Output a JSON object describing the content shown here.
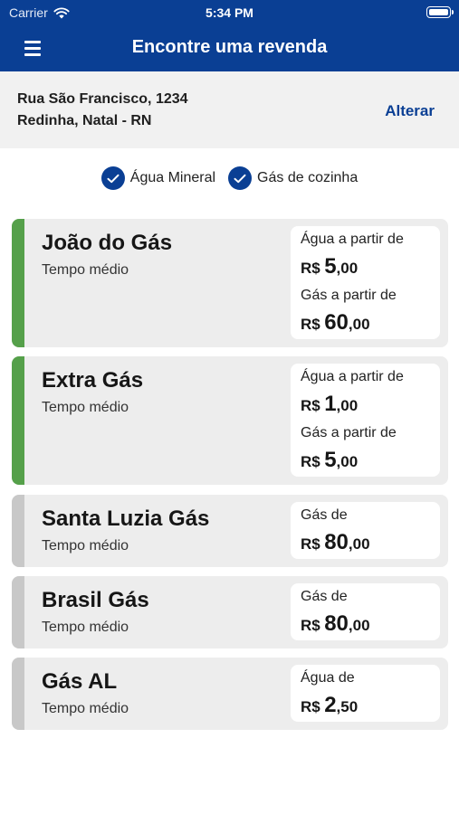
{
  "status_bar": {
    "carrier": "Carrier",
    "time": "5:34 PM"
  },
  "header": {
    "title": "Encontre uma revenda"
  },
  "address": {
    "line1": "Rua São Francisco, 1234",
    "line2": "Redinha, Natal - RN",
    "change_label": "Alterar"
  },
  "filters": [
    {
      "label": "Água Mineral",
      "checked": true
    },
    {
      "label": "Gás de cozinha",
      "checked": true
    }
  ],
  "colors": {
    "brand": "#0a3f94",
    "open_bar": "#55a04a",
    "closed_bar": "#c8c8c8"
  },
  "stores": [
    {
      "name": "João do Gás",
      "subtitle": "Tempo médio",
      "open": true,
      "prices": [
        {
          "label": "Água a partir de",
          "currency": "R$",
          "int": "5",
          "cents": ",00"
        },
        {
          "label": "Gás a partir de",
          "currency": "R$",
          "int": "60",
          "cents": ",00"
        }
      ]
    },
    {
      "name": "Extra Gás",
      "subtitle": "Tempo médio",
      "open": true,
      "prices": [
        {
          "label": "Água a partir de",
          "currency": "R$",
          "int": "1",
          "cents": ",00"
        },
        {
          "label": "Gás a partir de",
          "currency": "R$",
          "int": "5",
          "cents": ",00"
        }
      ]
    },
    {
      "name": "Santa Luzia Gás",
      "subtitle": "Tempo médio",
      "open": false,
      "prices": [
        {
          "label": "Gás de",
          "currency": "R$",
          "int": "80",
          "cents": ",00"
        }
      ]
    },
    {
      "name": "Brasil Gás",
      "subtitle": "Tempo médio",
      "open": false,
      "prices": [
        {
          "label": "Gás de",
          "currency": "R$",
          "int": "80",
          "cents": ",00"
        }
      ]
    },
    {
      "name": "Gás AL",
      "subtitle": "Tempo médio",
      "open": false,
      "prices": [
        {
          "label": "Água de",
          "currency": "R$",
          "int": "2",
          "cents": ",50"
        }
      ]
    }
  ]
}
